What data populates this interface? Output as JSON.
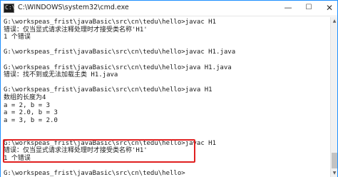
{
  "window": {
    "title": "C:\\WINDOWS\\system32\\cmd.exe",
    "icon": "cmd-icon",
    "controls": {
      "minimize": "—",
      "maximize": "☐",
      "close": "✕"
    }
  },
  "console": {
    "lines": [
      "G:\\workspeas_frist\\javaBasic\\src\\cn\\tedu\\hello>javac H1",
      "错误：仅当显式请求注释处理时才接受类名称'H1'",
      "1 个错误",
      "",
      "G:\\workspeas_frist\\javaBasic\\src\\cn\\tedu\\hello>javac H1.java",
      "",
      "G:\\workspeas_frist\\javaBasic\\src\\cn\\tedu\\hello>java H1.java",
      "错误：找不到或无法加载主类 H1.java",
      "",
      "G:\\workspeas_frist\\javaBasic\\src\\cn\\tedu\\hello>java H1",
      "数组的长度为4",
      "a = 2, b = 3",
      "a = 2.0, b = 3",
      "a = 3, b = 2.0",
      "",
      "",
      "G:\\workspeas_frist\\javaBasic\\src\\cn\\tedu\\hello>javac H1",
      "错误：仅当显式请求注释处理时才接受类名称'H1'",
      "1 个错误",
      "",
      "G:\\workspeas_frist\\javaBasic\\src\\cn\\tedu\\hello>"
    ]
  },
  "highlight_color": "#e02020",
  "scrollbar": {
    "up": "▲",
    "down": "▼"
  }
}
